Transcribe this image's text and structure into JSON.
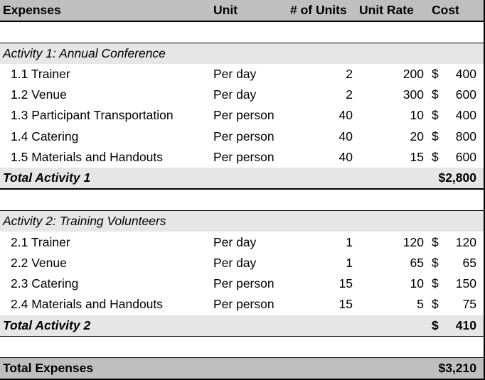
{
  "header": {
    "expenses": "Expenses",
    "unit": "Unit",
    "num_units": "# of Units",
    "unit_rate": "Unit Rate",
    "cost": "Cost"
  },
  "activities": [
    {
      "title": "Activity 1: Annual Conference",
      "items": [
        {
          "name": "1.1 Trainer",
          "unit": "Per day",
          "num": "2",
          "rate": "200",
          "currency": "$",
          "cost": "400"
        },
        {
          "name": "1.2 Venue",
          "unit": "Per day",
          "num": "2",
          "rate": "300",
          "currency": "$",
          "cost": "600"
        },
        {
          "name": "1.3 Participant Transportation",
          "unit": "Per person",
          "num": "40",
          "rate": "10",
          "currency": "$",
          "cost": "400"
        },
        {
          "name": "1.4 Catering",
          "unit": "Per person",
          "num": "40",
          "rate": "20",
          "currency": "$",
          "cost": "800"
        },
        {
          "name": "1.5 Materials and Handouts",
          "unit": "Per person",
          "num": "40",
          "rate": "15",
          "currency": "$",
          "cost": "600"
        }
      ],
      "total_label": "Total Activity 1",
      "total_value": "$2,800"
    },
    {
      "title": "Activity 2: Training Volunteers",
      "items": [
        {
          "name": "2.1 Trainer",
          "unit": "Per day",
          "num": "1",
          "rate": "120",
          "currency": "$",
          "cost": "120"
        },
        {
          "name": "2.2 Venue",
          "unit": "Per day",
          "num": "1",
          "rate": "65",
          "currency": "$",
          "cost": "65"
        },
        {
          "name": "2.3 Catering",
          "unit": "Per person",
          "num": "15",
          "rate": "10",
          "currency": "$",
          "cost": "150"
        },
        {
          "name": "2.4 Materials and Handouts",
          "unit": "Per person",
          "num": "15",
          "rate": "5",
          "currency": "$",
          "cost": "75"
        }
      ],
      "total_label": "Total Activity 2",
      "total_currency": "$",
      "total_value": "410"
    }
  ],
  "grand_total": {
    "label": "Total Expenses",
    "value": "$3,210"
  },
  "colors": {
    "header_bg": "#bfbfbf",
    "section_bg": "#e6e6e6",
    "grand_total_bg": "#bfbfbf"
  }
}
